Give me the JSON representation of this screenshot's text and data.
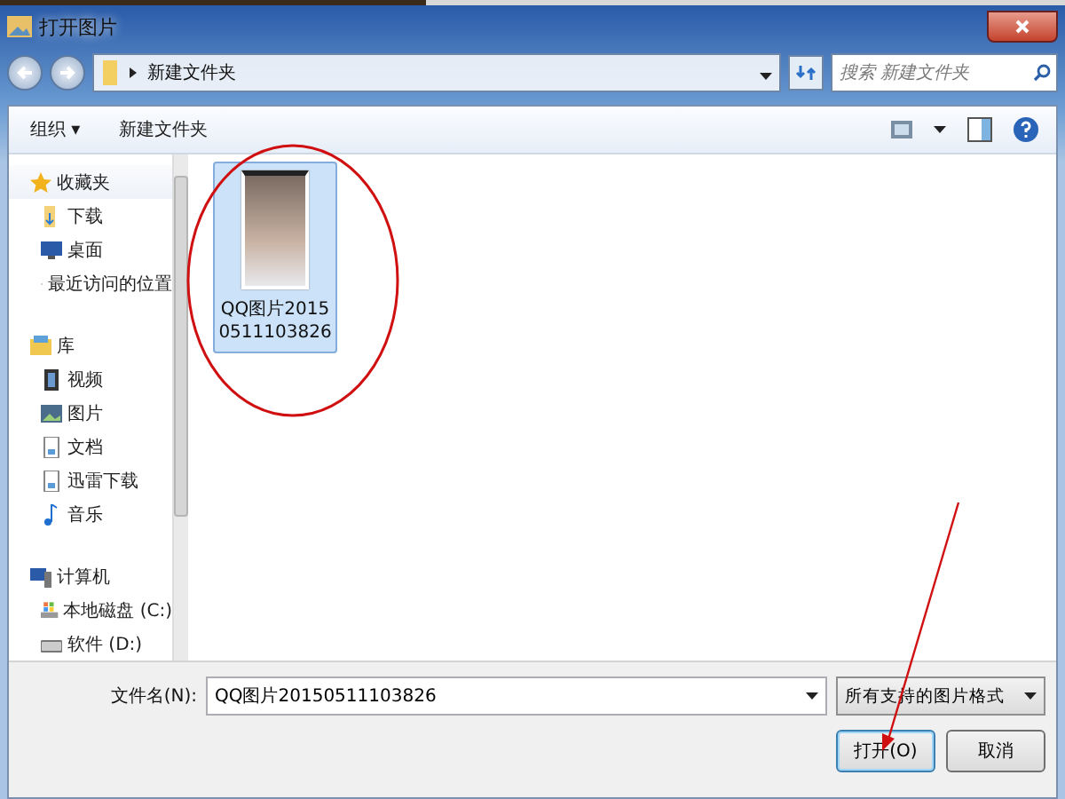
{
  "window": {
    "title": "打开图片"
  },
  "address": {
    "path": "新建文件夹",
    "search_placeholder": "搜索 新建文件夹"
  },
  "toolbar": {
    "organize": "组织 ▾",
    "new_folder": "新建文件夹"
  },
  "sidebar": {
    "groups": [
      {
        "label": "收藏夹",
        "children": [
          {
            "label": "下载"
          },
          {
            "label": "桌面"
          },
          {
            "label": "最近访问的位置"
          }
        ]
      },
      {
        "label": "库",
        "children": [
          {
            "label": "视频"
          },
          {
            "label": "图片"
          },
          {
            "label": "文档"
          },
          {
            "label": "迅雷下载"
          },
          {
            "label": "音乐"
          }
        ]
      },
      {
        "label": "计算机",
        "children": [
          {
            "label": "本地磁盘 (C:)"
          },
          {
            "label": "软件 (D:)"
          }
        ]
      }
    ]
  },
  "files": [
    {
      "name": "QQ图片20150511103826",
      "selected": true
    }
  ],
  "bottom": {
    "filename_label": "文件名(N):",
    "filename": "QQ图片20150511103826",
    "filetype": "所有支持的图片格式",
    "open": "打开(O)",
    "cancel": "取消"
  }
}
